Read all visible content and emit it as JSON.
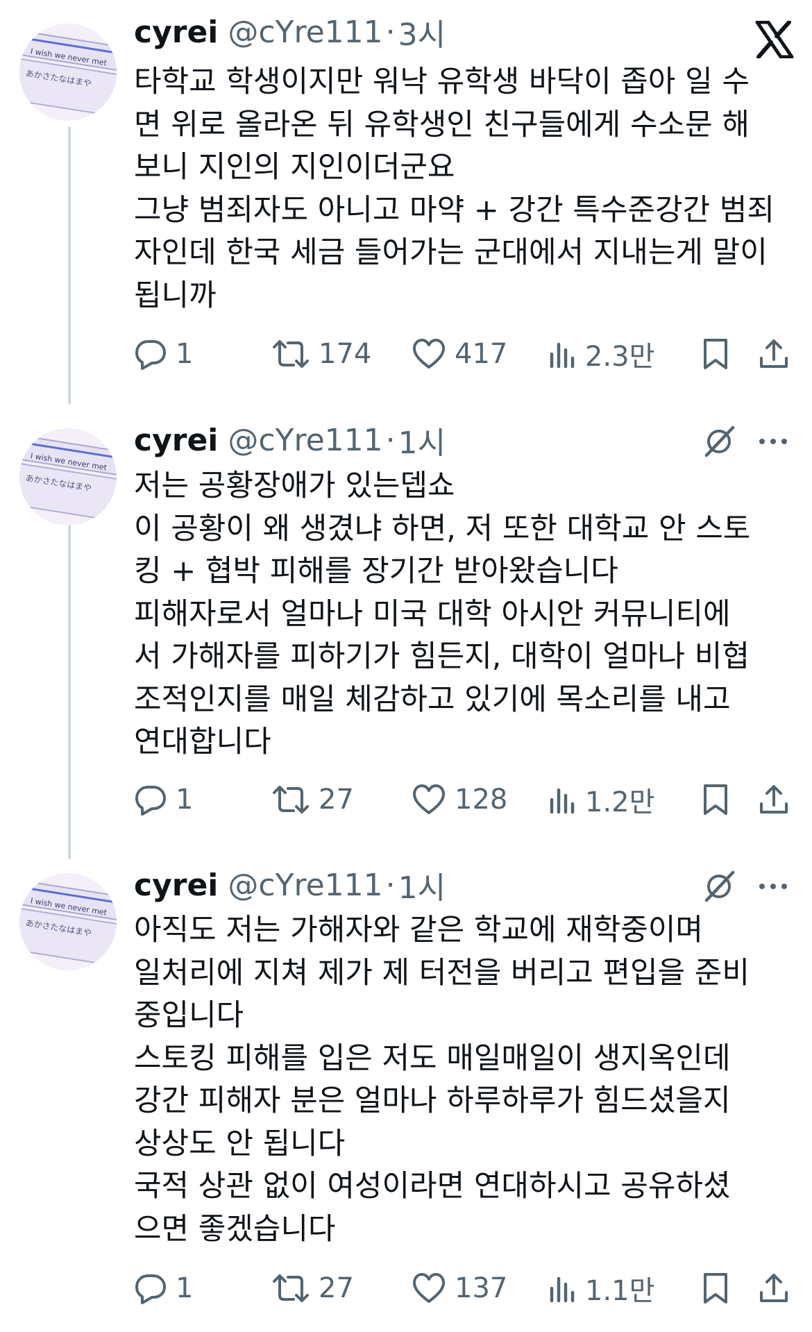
{
  "brand": {
    "icon": "x-logo-icon"
  },
  "tweets": [
    {
      "name": "cyrei",
      "handle": "@cYre111",
      "separator": "·",
      "time": "3시",
      "avatar_text": "I wish we never met",
      "avatar_kana": "あかさたなはまや",
      "lines": [
        "타학교 학생이지만 워낙 유학생 바닥이 좁아 일 수",
        "면 위로 올라온 뒤 유학생인 친구들에게 수소문 해",
        "보니 지인의 지인이더군요",
        "그냥 범죄자도 아니고 마약 + 강간 특수준강간 범죄",
        "자인데 한국 세금 들어가는 군대에서 지내는게 말이",
        "됩니까"
      ],
      "replies": "1",
      "retweets": "174",
      "likes": "417",
      "views": "2.3만"
    },
    {
      "name": "cyrei",
      "handle": "@cYre111",
      "separator": "·",
      "time": "1시",
      "avatar_text": "I wish we never met",
      "avatar_kana": "あかさたなはまや",
      "lines": [
        "저는 공황장애가 있는뎁쇼",
        "이 공황이 왜 생겼냐 하면, 저 또한 대학교 안 스토",
        "킹 + 협박 피해를 장기간 받아왔습니다",
        "피해자로서 얼마나 미국 대학 아시안 커뮤니티에",
        "서 가해자를 피하기가 힘든지, 대학이 얼마나 비협",
        "조적인지를 매일 체감하고 있기에 목소리를 내고",
        "연대합니다"
      ],
      "replies": "1",
      "retweets": "27",
      "likes": "128",
      "views": "1.2만"
    },
    {
      "name": "cyrei",
      "handle": "@cYre111",
      "separator": "·",
      "time": "1시",
      "avatar_text": "I wish we never met",
      "avatar_kana": "あかさたなはまや",
      "lines": [
        "아직도 저는 가해자와 같은 학교에 재학중이며",
        "일처리에 지쳐 제가 제 터전을 버리고 편입을 준비",
        "중입니다",
        "스토킹 피해를 입은 저도 매일매일이 생지옥인데",
        "강간 피해자 분은 얼마나 하루하루가 힘드셨을지",
        "상상도 안 됩니다",
        "국적 상관 없이 여성이라면 연대하시고 공유하셨",
        "으면 좋겠습니다"
      ],
      "replies": "1",
      "retweets": "27",
      "likes": "137",
      "views": "1.1만"
    }
  ],
  "icons": {
    "reply": "reply-icon",
    "retweet": "retweet-icon",
    "like": "heart-icon",
    "views": "views-icon",
    "bookmark": "bookmark-icon",
    "share": "share-icon",
    "grok": "grok-icon",
    "more": "more-icon"
  },
  "colors": {
    "text": "#0f1419",
    "muted": "#536471",
    "thread": "#cfd9de"
  }
}
